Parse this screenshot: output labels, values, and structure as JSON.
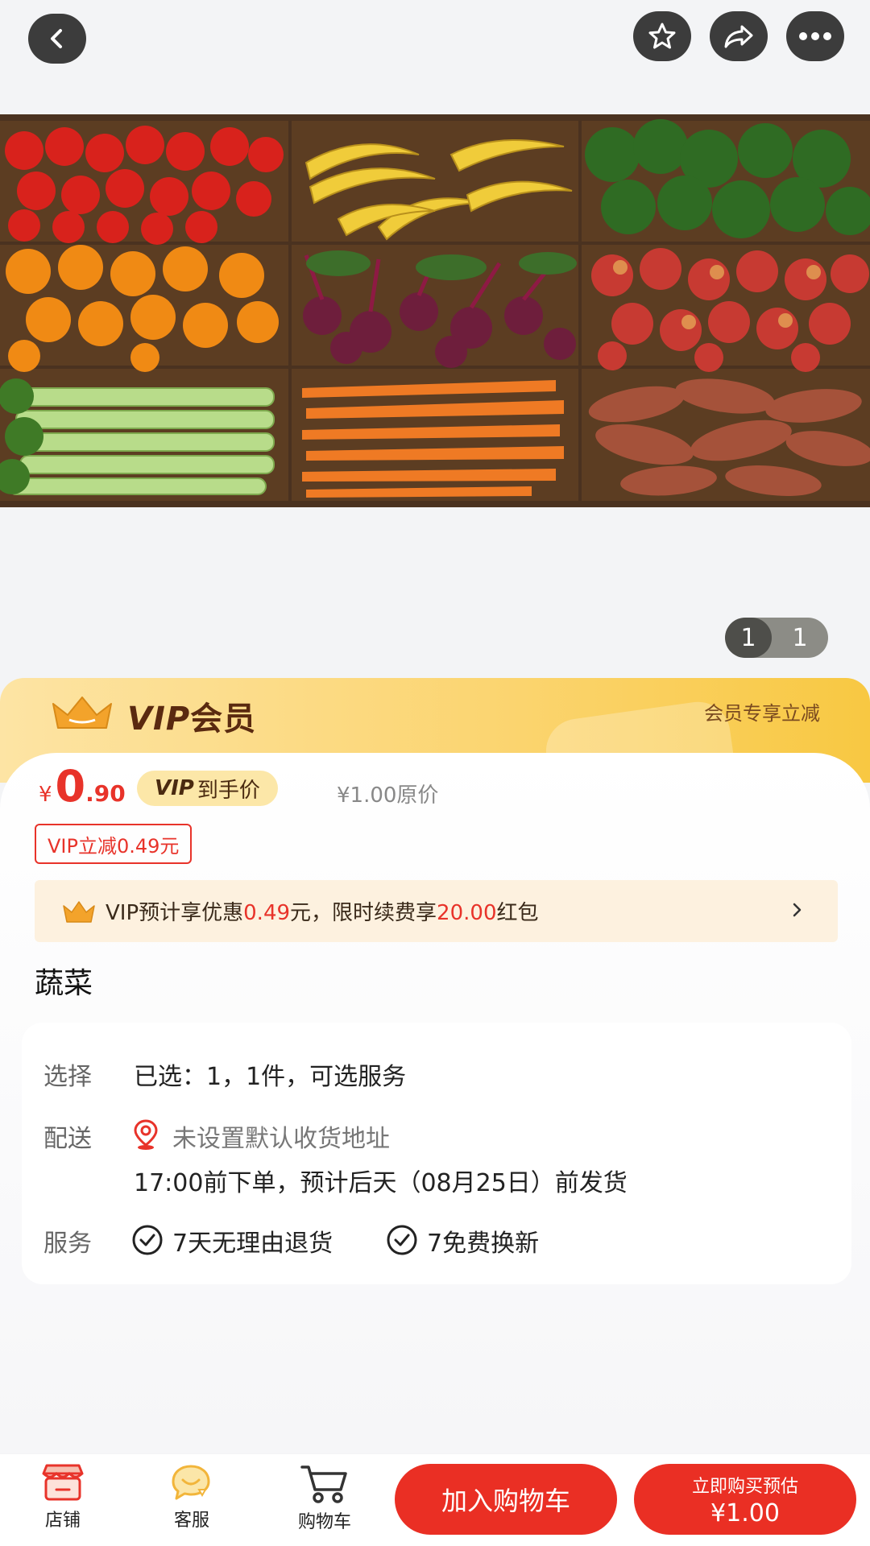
{
  "pager": {
    "current": "1",
    "total": "1"
  },
  "vip_banner": {
    "title_latin": "VIP",
    "title_cn": "会员",
    "right_text": "会员专享立减"
  },
  "price": {
    "currency": "¥",
    "integer": "0",
    "decimal": ".90",
    "vip_pill_latin": "VIP",
    "vip_pill_text": "到手价",
    "original": "¥1.00原价"
  },
  "coupon": "VIP立减0.49元",
  "promo": {
    "pre": "VIP预计享优惠",
    "amount1": "0.49",
    "mid": "元，限时续费享",
    "amount2": "20.00",
    "post": "红包"
  },
  "product": {
    "title": "蔬菜"
  },
  "info": {
    "select_label": "选择",
    "select_value": "已选：1，1件，可选服务",
    "delivery_label": "配送",
    "delivery_address": "未设置默认收货地址",
    "delivery_eta": "17:00前下单，预计后天（08月25日）前发货",
    "service_label": "服务",
    "service_1": "7天无理由退货",
    "service_2": "7免费换新"
  },
  "bottom": {
    "shop": "店铺",
    "service": "客服",
    "cart": "购物车",
    "add_to_cart": "加入购物车",
    "buy_now": "立即购买预估",
    "buy_price": "¥1.00"
  },
  "colors": {
    "accent_red": "#ea2f24",
    "vip_gold": "#fbd46e",
    "promo_bg": "#fdf1df"
  }
}
